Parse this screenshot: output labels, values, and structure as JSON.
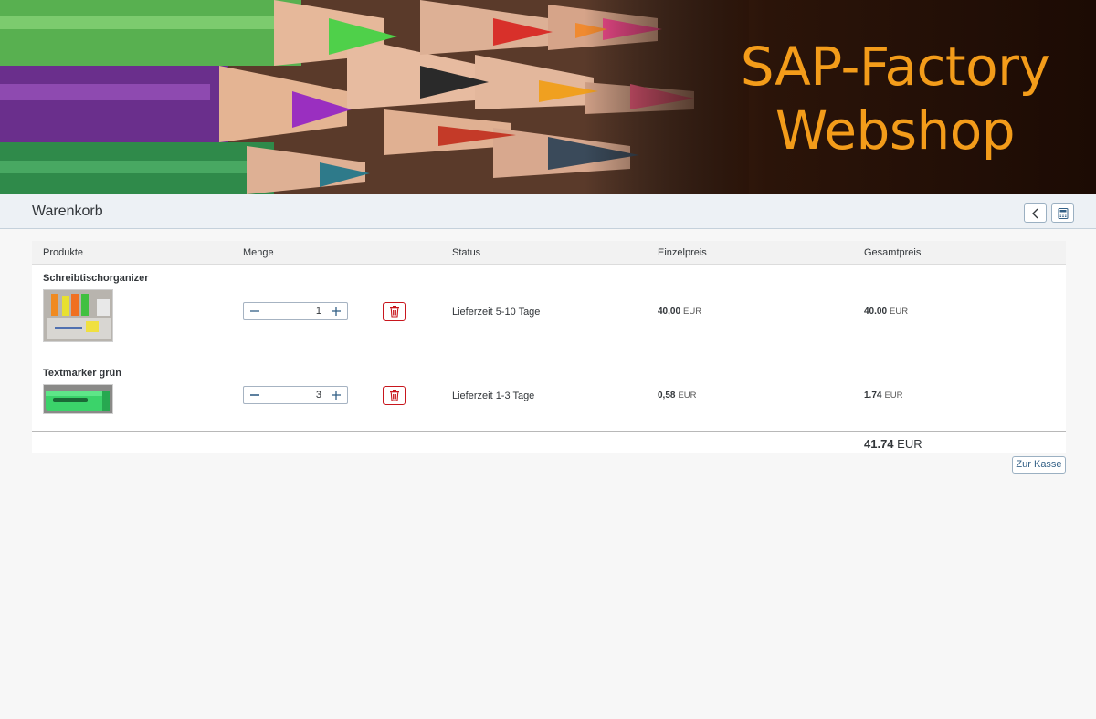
{
  "banner": {
    "line1": "SAP-Factory",
    "line2": "Webshop"
  },
  "header": {
    "title": "Warenkorb",
    "back_icon": "chevron-left-icon",
    "calc_icon": "calculator-icon"
  },
  "table": {
    "columns": [
      "Produkte",
      "Menge",
      "Status",
      "Einzelpreis",
      "Gesamtpreis"
    ],
    "rows": [
      {
        "name": "Schreibtischorganizer",
        "quantity": "1",
        "status": "Lieferzeit 5-10 Tage",
        "unit_price": "40,00",
        "unit_currency": "EUR",
        "total_price": "40.00",
        "total_currency": "EUR"
      },
      {
        "name": "Textmarker grün",
        "quantity": "3",
        "status": "Lieferzeit 1-3 Tage",
        "unit_price": "0,58",
        "unit_currency": "EUR",
        "total_price": "1.74",
        "total_currency": "EUR"
      }
    ]
  },
  "summary": {
    "total": "41.74",
    "currency": "EUR"
  },
  "actions": {
    "checkout_label": "Zur Kasse"
  },
  "colors": {
    "accent": "#f39c1a",
    "link": "#346187",
    "delete": "#c8161d"
  }
}
